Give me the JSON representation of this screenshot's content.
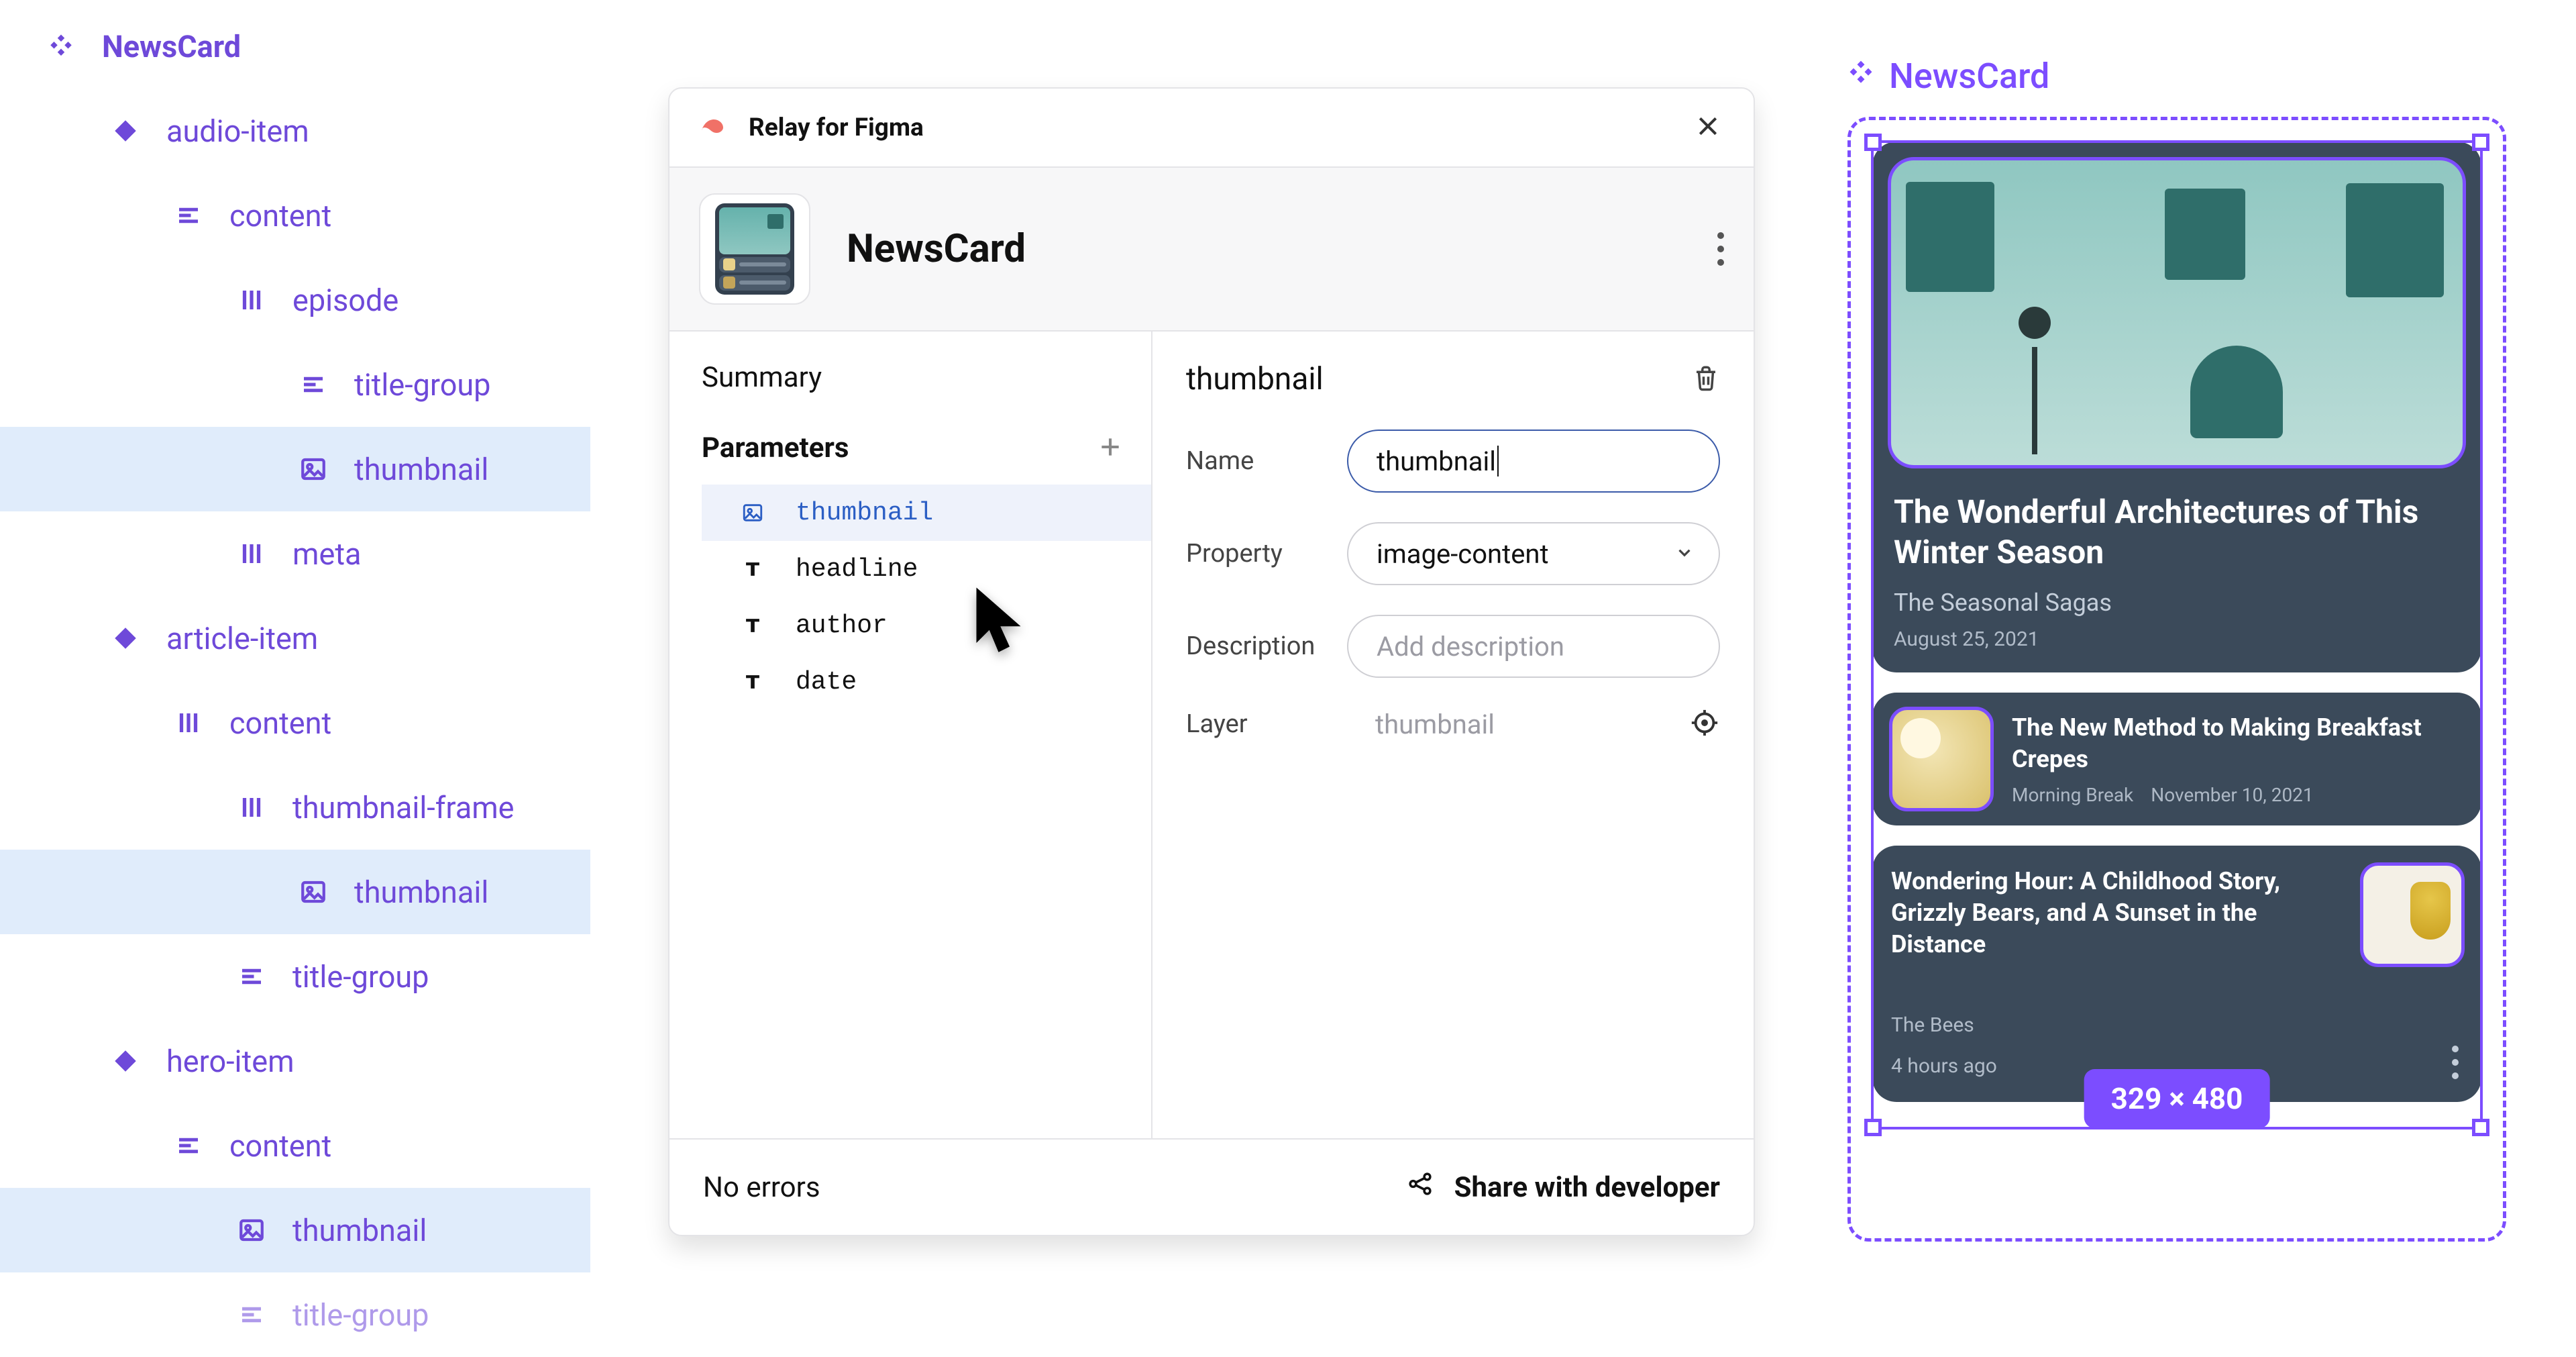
{
  "tree": {
    "root": "NewsCard",
    "items": [
      {
        "lv": 0,
        "icon": "component",
        "label": "NewsCard",
        "bold": true
      },
      {
        "lv": 1,
        "icon": "instance",
        "label": "audio-item"
      },
      {
        "lv": 2,
        "icon": "frame",
        "label": "content"
      },
      {
        "lv": 3,
        "icon": "autolayout",
        "label": "episode"
      },
      {
        "lv": 4,
        "icon": "frame",
        "label": "title-group"
      },
      {
        "lv": 4,
        "icon": "image",
        "label": "thumbnail",
        "selected": true
      },
      {
        "lv": 3,
        "icon": "autolayout",
        "label": "meta"
      },
      {
        "lv": 1,
        "icon": "instance",
        "label": "article-item"
      },
      {
        "lv": 2,
        "icon": "autolayout",
        "label": "content"
      },
      {
        "lv": 3,
        "icon": "autolayout",
        "label": "thumbnail-frame"
      },
      {
        "lv": 4,
        "icon": "image",
        "label": "thumbnail",
        "selected": true
      },
      {
        "lv": 3,
        "icon": "frame",
        "label": "title-group"
      },
      {
        "lv": 1,
        "icon": "instance",
        "label": "hero-item"
      },
      {
        "lv": 2,
        "icon": "frame",
        "label": "content"
      },
      {
        "lv": 3,
        "icon": "image",
        "label": "thumbnail",
        "selected": true
      },
      {
        "lv": 3,
        "icon": "frame",
        "label": "title-group"
      }
    ]
  },
  "panel": {
    "app_title": "Relay for Figma",
    "component_name": "NewsCard",
    "left": {
      "summary": "Summary",
      "parameters": "Parameters",
      "params": [
        {
          "icon": "image",
          "name": "thumbnail",
          "selected": true
        },
        {
          "icon": "text",
          "name": "headline"
        },
        {
          "icon": "text",
          "name": "author"
        },
        {
          "icon": "text",
          "name": "date"
        }
      ]
    },
    "right": {
      "header": "thumbnail",
      "rows": {
        "name_label": "Name",
        "name_value": "thumbnail",
        "property_label": "Property",
        "property_value": "image-content",
        "description_label": "Description",
        "description_placeholder": "Add description",
        "layer_label": "Layer",
        "layer_value": "thumbnail"
      }
    },
    "footer": {
      "status": "No errors",
      "share": "Share with developer"
    }
  },
  "canvas": {
    "label": "NewsCard",
    "dimensions": "329 × 480",
    "hero": {
      "title": "The Wonderful Architectures of This Winter Season",
      "subtitle": "The Seasonal Sagas",
      "date": "August 25, 2021"
    },
    "article": {
      "title": "The New Method to Making Breakfast Crepes",
      "source": "Morning Break",
      "date": "November 10, 2021"
    },
    "audio": {
      "title": "Wondering Hour: A Childhood Story, Grizzly Bears, and A Sunset in the Distance",
      "source": "The Bees",
      "ago": "4 hours ago"
    }
  }
}
